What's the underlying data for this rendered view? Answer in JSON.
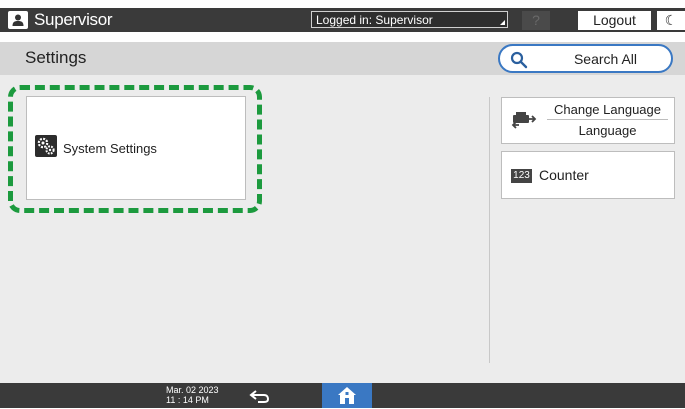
{
  "header": {
    "user_name": "Supervisor",
    "logged_in_text": "Logged in: Supervisor",
    "help_label": "?",
    "logout_label": "Logout",
    "moon_label": "☾"
  },
  "title_bar": {
    "title": "Settings",
    "search_label": "Search All"
  },
  "main": {
    "system_settings_label": "System Settings",
    "change_language_label": "Change Language",
    "language_label": "Language",
    "counter_badge": "123",
    "counter_label": "Counter"
  },
  "footer": {
    "date": "Mar. 02 2023",
    "time": "11 : 14 PM"
  },
  "colors": {
    "accent_blue": "#3a78c3",
    "highlight_green": "#1c9a3e",
    "dark_bar": "#3a3a3a"
  },
  "icons": [
    "user-icon",
    "search-icon",
    "gears-icon",
    "language-icon",
    "counter-icon",
    "back-icon",
    "home-icon",
    "moon-icon"
  ]
}
